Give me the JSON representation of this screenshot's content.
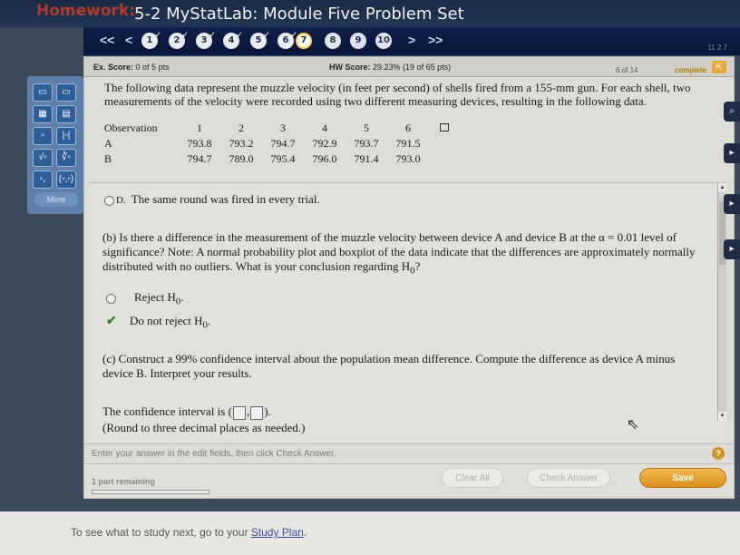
{
  "header": {
    "tag": "Homework:",
    "title": "5-2 MyStatLab: Module Five Problem Set"
  },
  "nav": {
    "prev_all": "<<",
    "prev": "<",
    "next": ">",
    "next_all": ">>",
    "questions": [
      "1",
      "2",
      "3",
      "4",
      "5",
      "6",
      "7",
      "8",
      "9",
      "10"
    ],
    "page_counter": "11 2 7"
  },
  "scores": {
    "ex_label": "Ex. Score:",
    "ex_value": "0 of 5 pts",
    "hw_label": "HW Score:",
    "hw_value": "29.23% (19 of 65 pts)",
    "progress_count": "6 of 14",
    "progress_label": "complete"
  },
  "problem": {
    "text": "The following data represent the muzzle velocity (in feet per second) of shells fired from a 155-mm gun. For each shell, two measurements of the velocity were recorded using two different measuring devices, resulting in the following data.",
    "table": {
      "header_label": "Observation",
      "columns": [
        "1",
        "2",
        "3",
        "4",
        "5",
        "6"
      ],
      "rows": [
        {
          "label": "A",
          "values": [
            "793.8",
            "793.2",
            "794.7",
            "792.9",
            "793.7",
            "791.5"
          ]
        },
        {
          "label": "B",
          "values": [
            "794.7",
            "789.0",
            "795.4",
            "796.0",
            "791.4",
            "793.0"
          ]
        }
      ]
    }
  },
  "option_d": {
    "letter": "D.",
    "text": "The same round was fired in every trial."
  },
  "part_b": {
    "text": "(b) Is there a difference in the measurement of the muzzle velocity between device A and device B at the α = 0.01 level of significance? Note: A normal probability plot and boxplot of the data indicate that the differences are approximately normally distributed with no outliers. What is your conclusion regarding H",
    "text_end": "?",
    "options": [
      {
        "label": "Reject H",
        "selected": false
      },
      {
        "label": "Do not reject H",
        "selected": true
      }
    ],
    "subscript": "0",
    "period": "."
  },
  "part_c": {
    "text": "(c) Construct a 99% confidence interval about the population mean difference. Compute the difference as device A minus device B. Interpret your results.",
    "ci_prefix": "The confidence interval is (",
    "ci_comma": ",",
    "ci_suffix": ").",
    "round_note": "(Round to three decimal places as needed.)"
  },
  "instructions": "Enter your answer in the edit fields, then click Check Answer.",
  "help": "?",
  "actions": {
    "remaining": "1 part remaining",
    "remaining_progress": 0,
    "clear": "Clear All",
    "check": "Check Answer",
    "save": "Save"
  },
  "tools": {
    "more": "More",
    "glyphs": [
      "▭",
      "▭",
      "▦",
      "▤",
      "▫",
      "|▫|",
      "√▫",
      "∛▫",
      "▫,",
      "(▫,▫)"
    ]
  },
  "footer": {
    "prefix": "To see what to study next, go to your ",
    "link": "Study Plan",
    "suffix": "."
  }
}
